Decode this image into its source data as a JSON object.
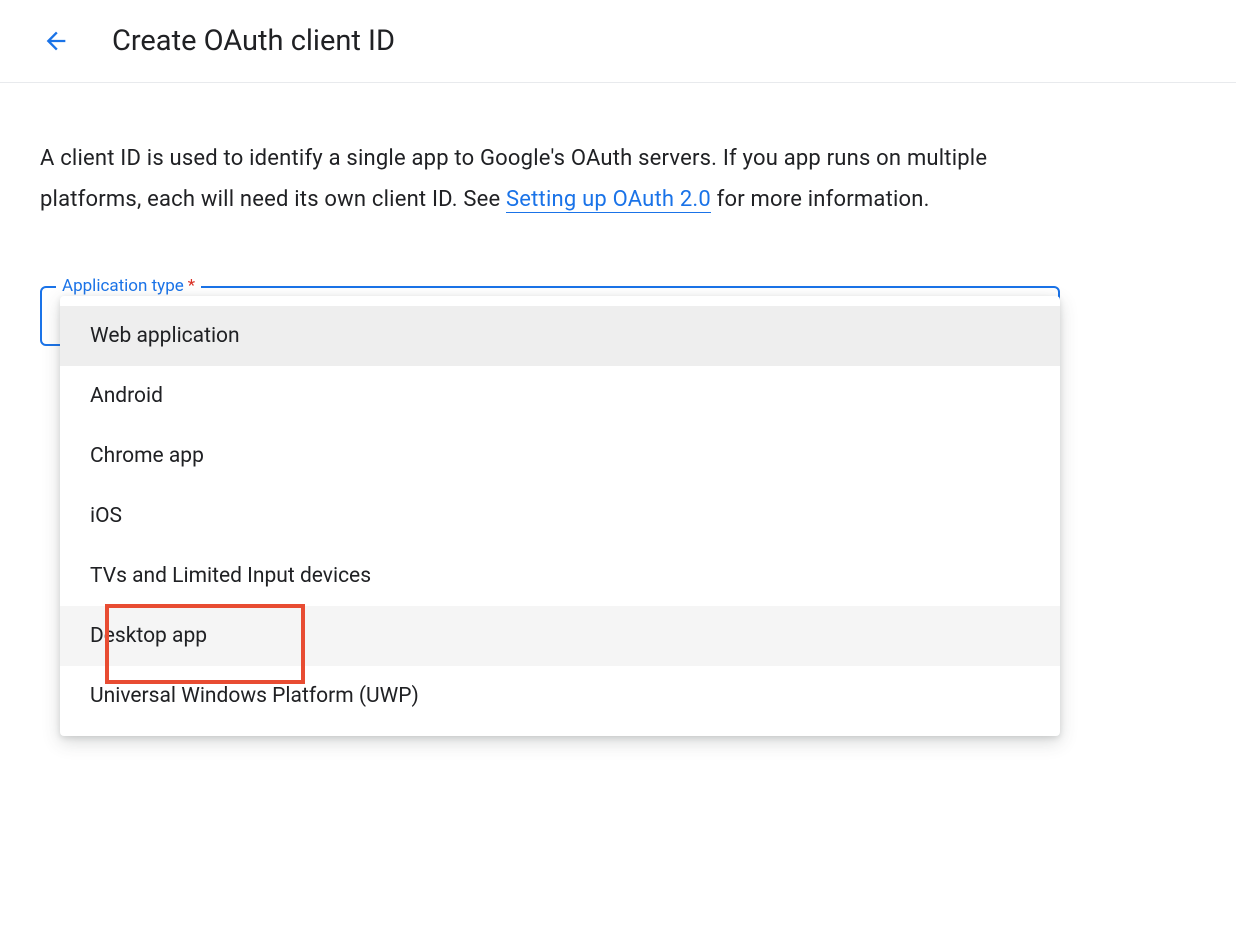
{
  "header": {
    "title": "Create OAuth client ID"
  },
  "description": {
    "text_before_link": "A client ID is used to identify a single app to Google's OAuth servers. If you app runs on multiple platforms, each will need its own client ID. See ",
    "link_text": "Setting up OAuth 2.0",
    "text_after_link": " for more information."
  },
  "field": {
    "label": "Application type",
    "required_indicator": "*"
  },
  "dropdown": {
    "options": [
      {
        "label": "Web application",
        "state": "selected"
      },
      {
        "label": "Android",
        "state": "normal"
      },
      {
        "label": "Chrome app",
        "state": "normal"
      },
      {
        "label": "iOS",
        "state": "normal"
      },
      {
        "label": "TVs and Limited Input devices",
        "state": "normal"
      },
      {
        "label": "Desktop app",
        "state": "hovered",
        "highlighted": true
      },
      {
        "label": "Universal Windows Platform (UWP)",
        "state": "normal"
      }
    ]
  },
  "colors": {
    "primary": "#1a73e8",
    "highlight_box": "#e84c32",
    "required": "#d93025"
  }
}
